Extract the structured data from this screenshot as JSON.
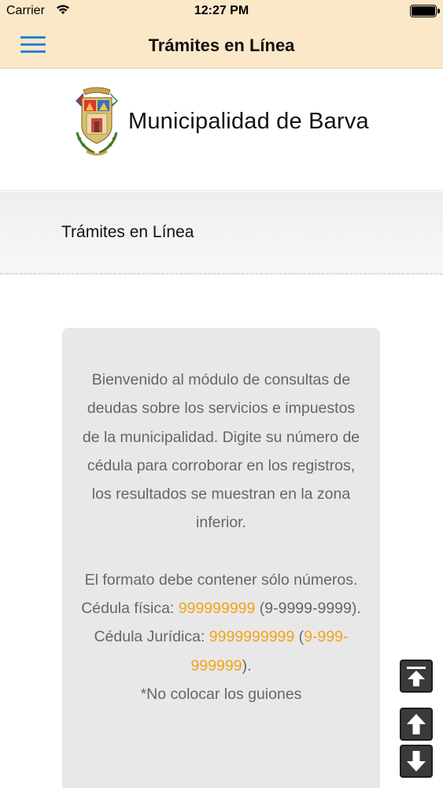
{
  "status_bar": {
    "carrier": "Carrier",
    "time": "12:27 PM"
  },
  "nav": {
    "title": "Trámites en Línea",
    "menu_icon": "hamburger-menu-icon"
  },
  "header": {
    "municipality_name": "Municipalidad de Barva",
    "logo": "municipality-crest-logo"
  },
  "section": {
    "title": "Trámites en Línea"
  },
  "info": {
    "welcome": "Bienvenido al módulo de consultas de deudas sobre los servicios e impuestos de la municipalidad. Digite su número de cédula para corroborar en los registros, los resultados se muestran en la zona inferior.",
    "format_intro": "El formato debe contener sólo números.",
    "fisica_label": "Cédula física: ",
    "fisica_example": "999999999",
    "fisica_dashed_open": " (",
    "fisica_dashed": "9-9999-9999",
    "fisica_close": ").",
    "juridica_label": "Cédula Jurídica: ",
    "juridica_example": "9999999999",
    "juridica_open": " (",
    "juridica_dashed": "9-999-999999",
    "juridica_close": ").",
    "note": "*No colocar los guiones"
  },
  "scroll_buttons": {
    "top_icon": "scroll-to-top-icon",
    "up_icon": "arrow-up-icon",
    "down_icon": "arrow-down-icon"
  },
  "colors": {
    "nav_bg": "#fbe8c8",
    "accent_blue": "#2e7fd6",
    "highlight_orange": "#f2a413",
    "card_bg": "#e8e8e9",
    "card_text": "#666666"
  }
}
